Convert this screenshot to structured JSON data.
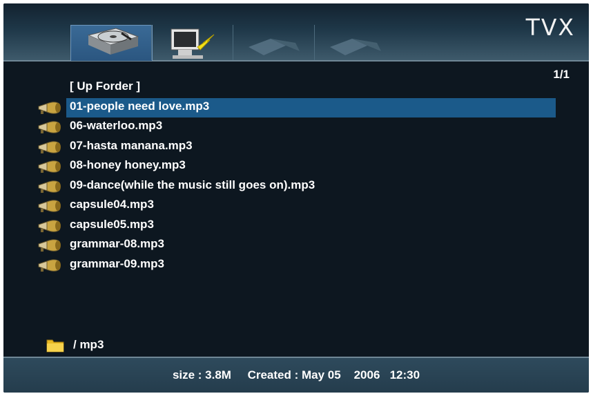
{
  "header": {
    "logo_text": "TVX",
    "source_tabs": [
      {
        "name": "hard-disk",
        "icon": "hard-disk-icon",
        "selected": true
      },
      {
        "name": "network",
        "icon": "network-computer-icon",
        "selected": false
      },
      {
        "name": "usb-1",
        "icon": "usb-plug-icon",
        "selected": false
      },
      {
        "name": "usb-2",
        "icon": "usb-plug-icon",
        "selected": false
      }
    ]
  },
  "page_indicator": "1/1",
  "file_list": {
    "up_folder_label": "[ Up Forder ]",
    "selected_index": 0,
    "items": [
      {
        "label": "01-people need love.mp3",
        "icon": "music-horn-icon"
      },
      {
        "label": "06-waterloo.mp3",
        "icon": "music-horn-icon"
      },
      {
        "label": "07-hasta manana.mp3",
        "icon": "music-horn-icon"
      },
      {
        "label": "08-honey honey.mp3",
        "icon": "music-horn-icon"
      },
      {
        "label": "09-dance(while the music still goes on).mp3",
        "icon": "music-horn-icon"
      },
      {
        "label": "capsule04.mp3",
        "icon": "music-horn-icon"
      },
      {
        "label": "capsule05.mp3",
        "icon": "music-horn-icon"
      },
      {
        "label": "grammar-08.mp3",
        "icon": "music-horn-icon"
      },
      {
        "label": "grammar-09.mp3",
        "icon": "music-horn-icon"
      }
    ]
  },
  "current_path": {
    "label": "/ mp3",
    "icon": "folder-icon"
  },
  "status_bar": {
    "text": "size : 3.8M     Created : May 05    2006   12:30"
  },
  "colors": {
    "background": "#0d1720",
    "selection": "#1b5a8a",
    "text": "#ffffff"
  }
}
